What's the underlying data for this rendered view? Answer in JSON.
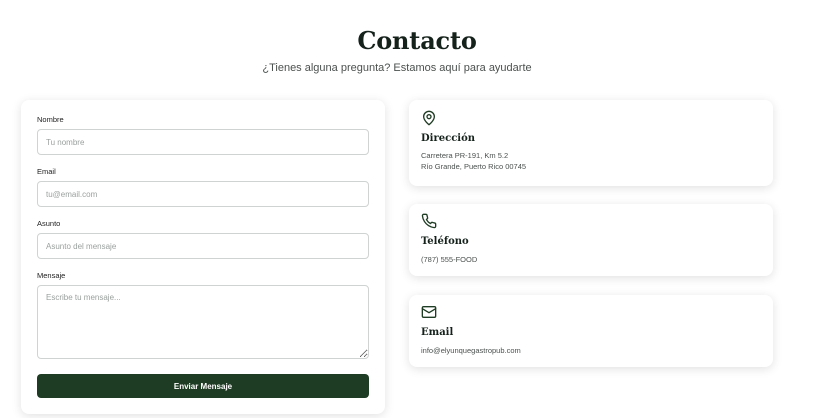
{
  "header": {
    "title": "Contacto",
    "subtitle": "¿Tienes alguna pregunta? Estamos aquí para ayudarte"
  },
  "form": {
    "name_label": "Nombre",
    "name_placeholder": "Tu nombre",
    "email_label": "Email",
    "email_placeholder": "tu@email.com",
    "subject_label": "Asunto",
    "subject_placeholder": "Asunto del mensaje",
    "message_label": "Mensaje",
    "message_placeholder": "Escribe tu mensaje...",
    "submit_label": "Enviar Mensaje"
  },
  "contact_info": {
    "address": {
      "icon": "map-pin-icon",
      "title": "Dirección",
      "line1": "Carretera PR-191, Km 5.2",
      "line2": "Río Grande, Puerto Rico 00745"
    },
    "phone": {
      "icon": "phone-icon",
      "title": "Teléfono",
      "value": "(787) 555-FOOD"
    },
    "email": {
      "icon": "mail-icon",
      "title": "Email",
      "value": "info@elyunquegastropub.com"
    }
  },
  "colors": {
    "brand_green": "#1e3b23",
    "title": "#15211b"
  }
}
